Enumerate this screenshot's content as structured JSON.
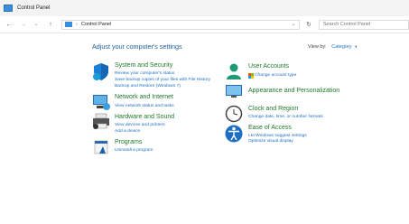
{
  "window": {
    "title": "Control Panel"
  },
  "nav": {
    "back_icon": "←",
    "forward_icon": "→",
    "recent_icon": "⌄",
    "up_icon": "↑",
    "breadcrumb": "Control Panel",
    "separator": "›",
    "address_dropdown_icon": "⌄",
    "refresh_icon": "↻",
    "search_placeholder": "Search Control Panel"
  },
  "main": {
    "heading": "Adjust your computer's settings",
    "view_by_label": "View by:",
    "view_by_value": "Category",
    "view_by_chevron": "▾"
  },
  "categories": {
    "system_security": {
      "title": "System and Security",
      "links": [
        "Review your computer's status",
        "Save backup copies of your files with File History",
        "Backup and Restore (Windows 7)"
      ]
    },
    "network": {
      "title": "Network and Internet",
      "links": [
        "View network status and tasks"
      ]
    },
    "hardware": {
      "title": "Hardware and Sound",
      "links": [
        "View devices and printers",
        "Add a device"
      ]
    },
    "programs": {
      "title": "Programs",
      "links": [
        "Uninstall a program"
      ]
    },
    "user_accounts": {
      "title": "User Accounts",
      "links": [
        "Change account type"
      ]
    },
    "appearance": {
      "title": "Appearance and Personalization",
      "links": []
    },
    "clock": {
      "title": "Clock and Region",
      "links": [
        "Change date, time, or number formats"
      ]
    },
    "ease": {
      "title": "Ease of Access",
      "links": [
        "Let Windows suggest settings",
        "Optimize visual display"
      ]
    }
  }
}
